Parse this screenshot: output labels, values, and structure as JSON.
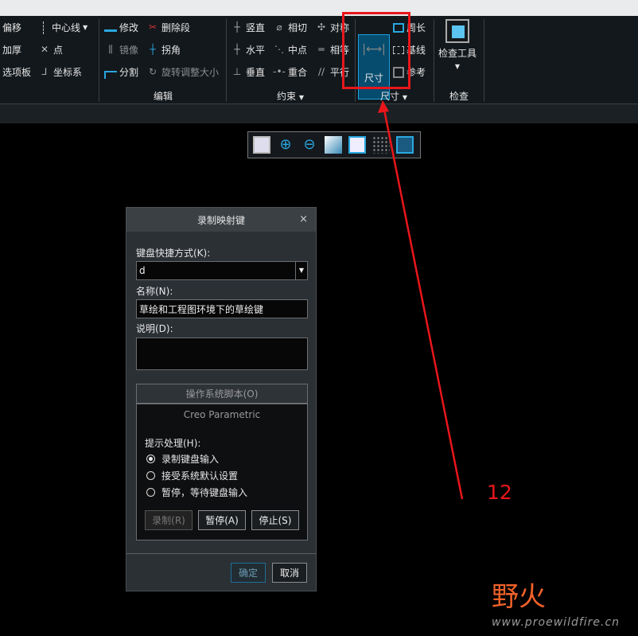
{
  "ribbon": {
    "left_col1": [
      "偏移",
      "加厚",
      "选项板"
    ],
    "left_col2": [
      "中心线",
      "点",
      "坐标系"
    ],
    "edit": {
      "items": [
        "修改",
        "删除段",
        "镜像",
        "拐角",
        "分割",
        "旋转调整大小"
      ],
      "label": "编辑"
    },
    "constrain": {
      "items": [
        "竖直",
        "相切",
        "对称",
        "水平",
        "中点",
        "相等",
        "垂直",
        "重合",
        "平行"
      ],
      "label": "约束"
    },
    "dimension": {
      "main": "尺寸",
      "items": [
        "周长",
        "基线",
        "参考"
      ],
      "label": "尺寸"
    },
    "inspect": {
      "tool": "检查工具",
      "label": "检查"
    }
  },
  "dialog": {
    "title": "录制映射键",
    "close": "×",
    "shortcut_label": "键盘快捷方式(K):",
    "shortcut_value": "d",
    "name_label": "名称(N):",
    "name_value": "草绘和工程图环境下的草绘键",
    "desc_label": "说明(D):",
    "desc_value": "",
    "tab_os": "操作系统脚本(O)",
    "tab_creo": "Creo Parametric",
    "prompt_label": "提示处理(H):",
    "radios": [
      "录制键盘输入",
      "接受系统默认设置",
      "暂停，等待键盘输入"
    ],
    "selected_radio": 0,
    "record": "录制(R)",
    "pause": "暂停(A)",
    "stop": "停止(S)",
    "ok": "确定",
    "cancel": "取消"
  },
  "annotation": {
    "number": "12",
    "color": "#e8161b"
  },
  "watermark": {
    "brand": "野火",
    "url": "www.proewildfire.cn"
  }
}
